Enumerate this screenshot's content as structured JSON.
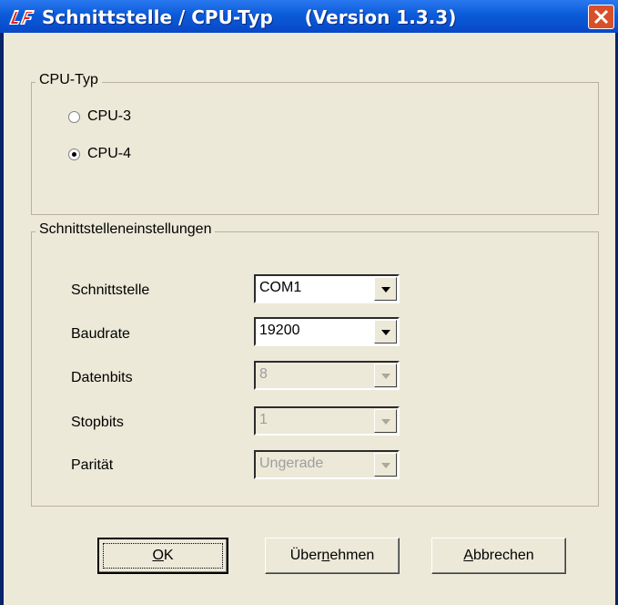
{
  "window": {
    "title": "Schnittstelle / CPU-Typ     (Version 1.3.3)",
    "colors": {
      "titlebar": "#0b5bd9",
      "close": "#d8502a",
      "face": "#ece9d8"
    }
  },
  "cpu_group": {
    "legend": "CPU-Typ",
    "options": [
      {
        "label": "CPU-3",
        "checked": false
      },
      {
        "label": "CPU-4",
        "checked": true
      }
    ]
  },
  "interface_group": {
    "legend": "Schnittstelleneinstellungen",
    "fields": [
      {
        "label": "Schnittstelle",
        "value": "COM1",
        "enabled": true
      },
      {
        "label": "Baudrate",
        "value": "19200",
        "enabled": true
      },
      {
        "label": "Datenbits",
        "value": "8",
        "enabled": false
      },
      {
        "label": "Stopbits",
        "value": "1",
        "enabled": false
      },
      {
        "label": "Parität",
        "value": "Ungerade",
        "enabled": false
      }
    ]
  },
  "buttons": {
    "ok": {
      "label_pre": "",
      "accel": "O",
      "label_post": "K"
    },
    "apply": {
      "label_pre": "Über",
      "accel": "n",
      "label_post": "ehmen"
    },
    "cancel": {
      "label_pre": "",
      "accel": "A",
      "label_post": "bbrechen"
    }
  },
  "icons": {
    "app": "app-logo-icon",
    "close": "close-icon",
    "dropdown": "chevron-down-icon"
  }
}
